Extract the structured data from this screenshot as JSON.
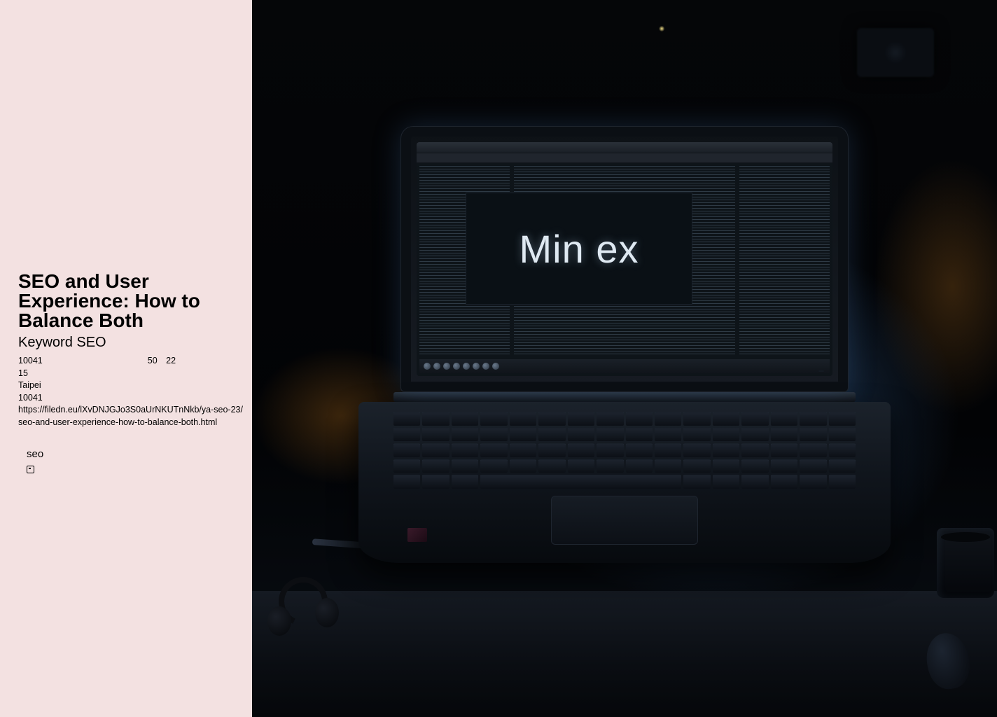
{
  "page": {
    "title": "SEO and User Experience: How to Balance Both",
    "subtitle": "Keyword SEO",
    "address_line": "10041            50 22  ",
    "number": "15",
    "city": "Taipei",
    "postal": "10041",
    "url": "https://filedn.eu/lXvDNJGJo3S0aUrNKUTnNkb/ya-seo-23/seo-and-user-experience-how-to-balance-both.html",
    "tag_label": "seo"
  },
  "hero": {
    "screen_brand": "Min ex"
  }
}
